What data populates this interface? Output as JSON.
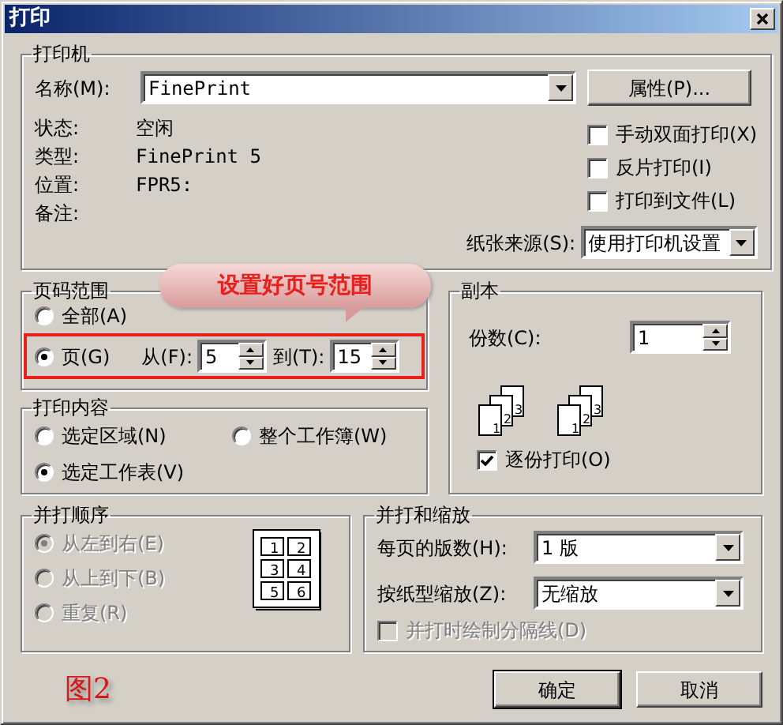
{
  "window": {
    "title": "打印"
  },
  "printer": {
    "legend": "打印机",
    "name_label": "名称(M):",
    "name_value": "FinePrint",
    "properties_button": "属性(P)...",
    "info": [
      {
        "label": "状态:",
        "value": "空闲"
      },
      {
        "label": "类型:",
        "value": "FinePrint 5"
      },
      {
        "label": "位置:",
        "value": "FPR5:"
      },
      {
        "label": "备注:"
      }
    ],
    "options": [
      {
        "label": "手动双面打印(X)",
        "checked": false
      },
      {
        "label": "反片打印(I)",
        "checked": false
      },
      {
        "label": "打印到文件(L)",
        "checked": false
      }
    ],
    "paper_source_label": "纸张来源(S):",
    "paper_source_value": "使用打印机设置"
  },
  "page_range": {
    "legend": "页码范围",
    "options": [
      {
        "label": "全部(A)",
        "selected": false
      },
      {
        "label": "页(G)",
        "selected": true
      }
    ],
    "from_label": "从(F):",
    "from_value": "5",
    "to_label": "到(T):",
    "to_value": "15"
  },
  "callout": "设置好页号范围",
  "copies": {
    "legend": "副本",
    "count_label": "份数(C):",
    "count_value": "1",
    "stacks": [
      [
        "1",
        "2",
        "3"
      ],
      [
        "1",
        "2",
        "3"
      ]
    ],
    "collate": {
      "label": "逐份打印(O)",
      "checked": true
    }
  },
  "print_what": {
    "legend": "打印内容",
    "options": [
      {
        "label": "选定区域(N)",
        "selected": false
      },
      {
        "label": "整个工作簿(W)",
        "selected": false
      },
      {
        "label": "选定工作表(V)",
        "selected": true
      }
    ]
  },
  "collate_order": {
    "legend": "并打顺序",
    "disabled": true,
    "options": [
      {
        "label": "从左到右(E)",
        "selected": true
      },
      {
        "label": "从上到下(B)",
        "selected": false
      },
      {
        "label": "重复(R)",
        "selected": false
      }
    ],
    "preview": [
      "1",
      "2",
      "3",
      "4",
      "5",
      "6"
    ]
  },
  "zoom": {
    "legend": "并打和缩放",
    "pages_per_sheet_label": "每页的版数(H):",
    "pages_per_sheet_value": "1 版",
    "scale_label": "按纸型缩放(Z):",
    "scale_value": "无缩放",
    "draw_borders": {
      "label": "并打时绘制分隔线(D)",
      "checked": false,
      "disabled": true
    }
  },
  "caption": "图2",
  "buttons": [
    "确定",
    "取消"
  ]
}
